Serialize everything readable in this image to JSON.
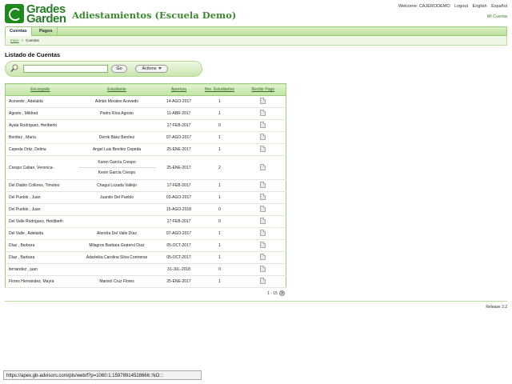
{
  "logo": {
    "line1": "Grades",
    "line2": "Garden"
  },
  "app_title": "Adiestamientos (Escuela Demo)",
  "topnav": {
    "welcome": "Welcome: CAJERODEMO",
    "logout": "Logout",
    "english": "English",
    "espanol": "Español",
    "mi_cuenta": "Mi Cuenta"
  },
  "tabs": [
    {
      "label": "Cuentas",
      "active": true
    },
    {
      "label": "Pagos",
      "active": false
    }
  ],
  "breadcrumb": {
    "home": "Inicio",
    "separator": ">",
    "current": "Cuentas"
  },
  "page_title": "Listado de Cuentas",
  "search": {
    "value": "",
    "go_label": "Go",
    "actions_label": "Actions"
  },
  "table": {
    "headers": [
      "Encargado",
      "Estudiante",
      "Apertura",
      "Nro. Estudiantes",
      "Recibir Pago"
    ],
    "rows": [
      {
        "encargado": "Acevedo , Adelaida",
        "estudiantes": [
          "Adrián Morales Acevedo"
        ],
        "apertura": "14-AGO-2017",
        "nro": "1"
      },
      {
        "encargado": "Agosto , Mildred",
        "estudiantes": [
          "Pedro Ríos Agosto"
        ],
        "apertura": "11-ABR-2017",
        "nro": "1"
      },
      {
        "encargado": "Ayala Rodríguez, Heriberto",
        "estudiantes": [],
        "apertura": "17-FEB-2017",
        "nro": "0"
      },
      {
        "encargado": "Benítez , María",
        "estudiantes": [
          "Derrik Báez Benítez"
        ],
        "apertura": "07-AGO-2017",
        "nro": "1"
      },
      {
        "encargado": "Cepeda Ortiz, Delma",
        "estudiantes": [
          "Angel Luis Benitez Cepeda"
        ],
        "apertura": "25-ENE-2017",
        "nro": "1"
      },
      {
        "encargado": "Crespo Caban, Veronica-",
        "estudiantes": [
          "Karen García Crespo",
          "Kevin García Crespo"
        ],
        "apertura": "25-ENE-2017",
        "nro": "2"
      },
      {
        "encargado": "Del Diablo Collores, Timoteo",
        "estudiantes": [
          "Chagui Lozada Vallejo"
        ],
        "apertura": "17-FEB-2017",
        "nro": "1"
      },
      {
        "encargado": "Del Pueblo , Juan",
        "estudiantes": [
          "Juanito Del Pueblo"
        ],
        "apertura": "03-AGO-2017",
        "nro": "1"
      },
      {
        "encargado": "Del Pueblo , Juan",
        "estudiantes": [],
        "apertura": "15-AGO-2018",
        "nro": "0"
      },
      {
        "encargado": "Del Valle Rodriguez, Heidibeth",
        "estudiantes": [],
        "apertura": "17-FEB-2017",
        "nro": "0"
      },
      {
        "encargado": "Del Valle , Adelaida",
        "estudiantes": [
          "Alondra Del Valle Díaz"
        ],
        "apertura": "07-AGO-2017",
        "nro": "1"
      },
      {
        "encargado": "Díaz , Barbara",
        "estudiantes": [
          "Milagros Barbara Graterol Díaz"
        ],
        "apertura": "05-OCT-2017",
        "nro": "1"
      },
      {
        "encargado": "Díaz , Barbara",
        "estudiantes": [
          "Adarleika Carolina Silva Contreras"
        ],
        "apertura": "05-OCT-2017",
        "nro": "1"
      },
      {
        "encargado": "fernandez , juan",
        "estudiantes": [],
        "apertura": "31-JUL-2018",
        "nro": "0"
      },
      {
        "encargado": "Flores Hernández, Mayra",
        "estudiantes": [
          "Marisol Cruz Flores"
        ],
        "apertura": "25-ENE-2017",
        "nro": "1"
      }
    ]
  },
  "pager": {
    "range": "1 - 15"
  },
  "release": "Release 3.2",
  "statusbar": "https://apex.gb-advisors.com/pls/web/f?p=1060:1:15978914528666::NO:::"
}
